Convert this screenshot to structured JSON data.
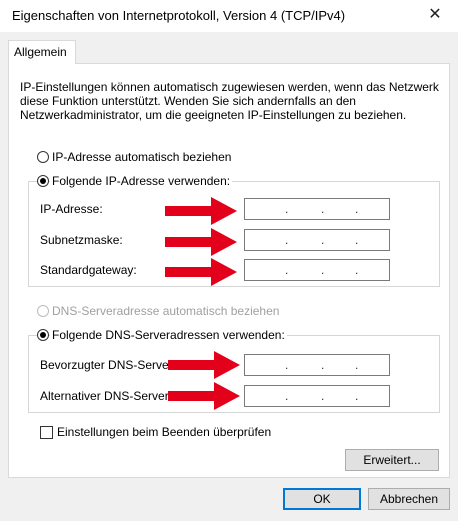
{
  "window": {
    "title": "Eigenschaften von Internetprotokoll, Version 4 (TCP/IPv4)",
    "close_glyph": "✕"
  },
  "tabs": [
    {
      "label": "Allgemein",
      "selected": true
    }
  ],
  "description": "IP-Einstellungen können automatisch zugewiesen werden, wenn das Netzwerk diese Funktion unterstützt. Wenden Sie sich andernfalls an den Netzwerkadministrator, um die geeigneten IP-Einstellungen zu beziehen.",
  "ip": {
    "auto_label": "IP-Adresse automatisch beziehen",
    "manual_label": "Folgende IP-Adresse verwenden:",
    "selected": "manual",
    "fields": [
      {
        "label": "IP-Adresse:",
        "value": ". . ."
      },
      {
        "label": "Subnetzmaske:",
        "value": ". . ."
      },
      {
        "label": "Standardgateway:",
        "value": ". . ."
      }
    ]
  },
  "dns": {
    "auto_label": "DNS-Serveradresse automatisch beziehen",
    "manual_label": "Folgende DNS-Serveradressen verwenden:",
    "selected": "manual",
    "fields": [
      {
        "label": "Bevorzugter DNS-Server:",
        "value": ". . ."
      },
      {
        "label": "Alternativer DNS-Server:",
        "value": ". . ."
      }
    ]
  },
  "validate_label": "Einstellungen beim Beenden überprüfen",
  "validate_checked": false,
  "buttons": {
    "advanced": "Erweitert...",
    "ok": "OK",
    "cancel": "Abbrechen"
  },
  "colors": {
    "arrow": "#e3001b",
    "accent": "#0078d7"
  }
}
